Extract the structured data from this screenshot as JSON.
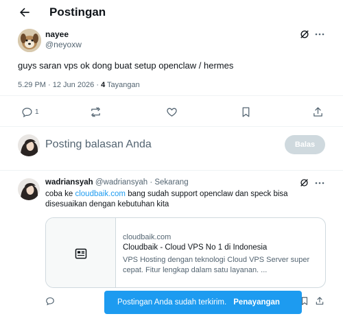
{
  "header": {
    "title": "Postingan"
  },
  "post": {
    "author_name": "nayee",
    "author_handle": "@neyoxw",
    "text": "guys saran vps ok dong buat setup openclaw / hermes",
    "time": "5.29 PM · 12 Jun 2026 · ",
    "views_count": "4",
    "views_label": " Tayangan",
    "reply_count": "1"
  },
  "reply_box": {
    "placeholder": "Posting balasan Anda",
    "button_label": "Balas"
  },
  "reply": {
    "author_name": "wadriansyah",
    "author_handle": "@wadriansyah",
    "separator": " · ",
    "time": "Sekarang",
    "text_before": "coba ke ",
    "link": "cloudbaik.com",
    "text_after": " bang sudah support openclaw dan speck bisa disesuaikan dengan kebutuhan kita",
    "card": {
      "domain": "cloudbaik.com",
      "title": "Cloudbaik - Cloud VPS No 1 di Indonesia",
      "description": "VPS Hosting dengan teknologi Cloud VPS Server super cepat. Fitur lengkap dalam satu layanan. ..."
    }
  },
  "toast": {
    "message": "Postingan Anda sudah terkirim.",
    "action": "Penayangan"
  },
  "colors": {
    "accent": "#1d9bf0",
    "muted": "#536471",
    "text": "#0f1419",
    "button_disabled": "#cfd9de"
  }
}
